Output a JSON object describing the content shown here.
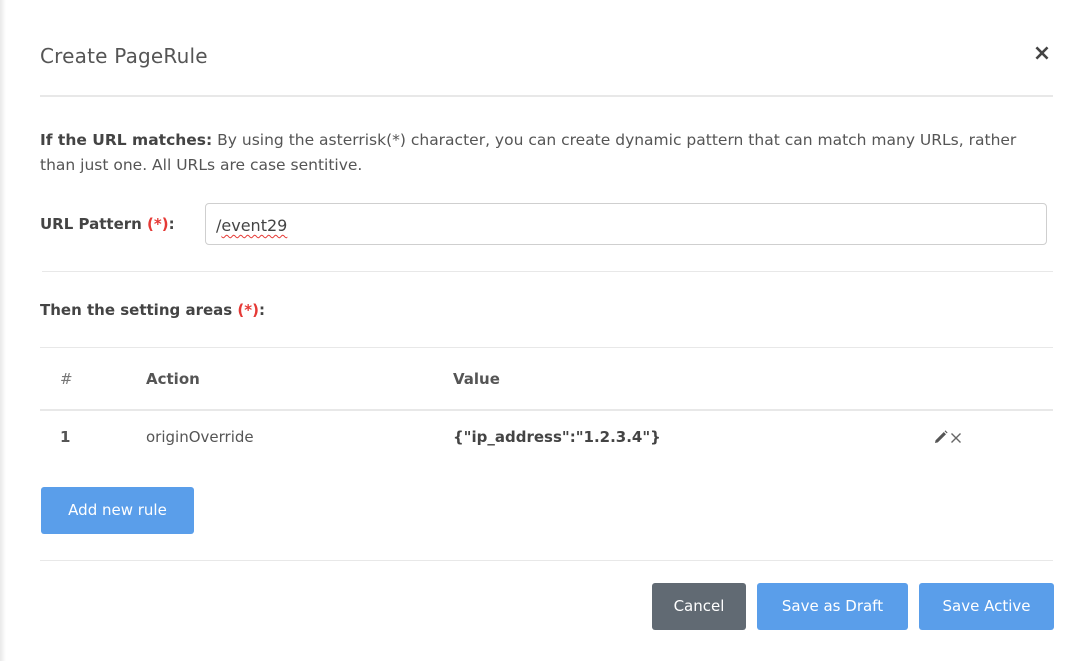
{
  "modal": {
    "title": "Create PageRule",
    "close_symbol": "×"
  },
  "intro": {
    "bold": "If the URL matches:",
    "text": " By using the asterrisk(*) character, you can create dynamic pattern that can match many URLs, rather than just one. All URLs are case sentitive."
  },
  "url_pattern": {
    "label": "URL Pattern ",
    "required_mark": "(*)",
    "colon": ":",
    "value_prefix": "/",
    "value_misspelled": "event29"
  },
  "settings": {
    "label": "Then the setting areas ",
    "required_mark": "(*)",
    "colon": ":"
  },
  "table": {
    "headers": {
      "hash": "#",
      "action": "Action",
      "value": "Value"
    },
    "rows": [
      {
        "num": "1",
        "action": "originOverride",
        "value": "{\"ip_address\":\"1.2.3.4\"}"
      }
    ]
  },
  "buttons": {
    "add_rule": "Add new rule",
    "cancel": "Cancel",
    "save_draft": "Save as Draft",
    "save_active": "Save Active"
  },
  "icons": {
    "edit": "pencil-icon",
    "delete": "close-icon"
  },
  "colors": {
    "primary": "#5a9eea",
    "secondary": "#616a73",
    "required": "#e53935"
  }
}
